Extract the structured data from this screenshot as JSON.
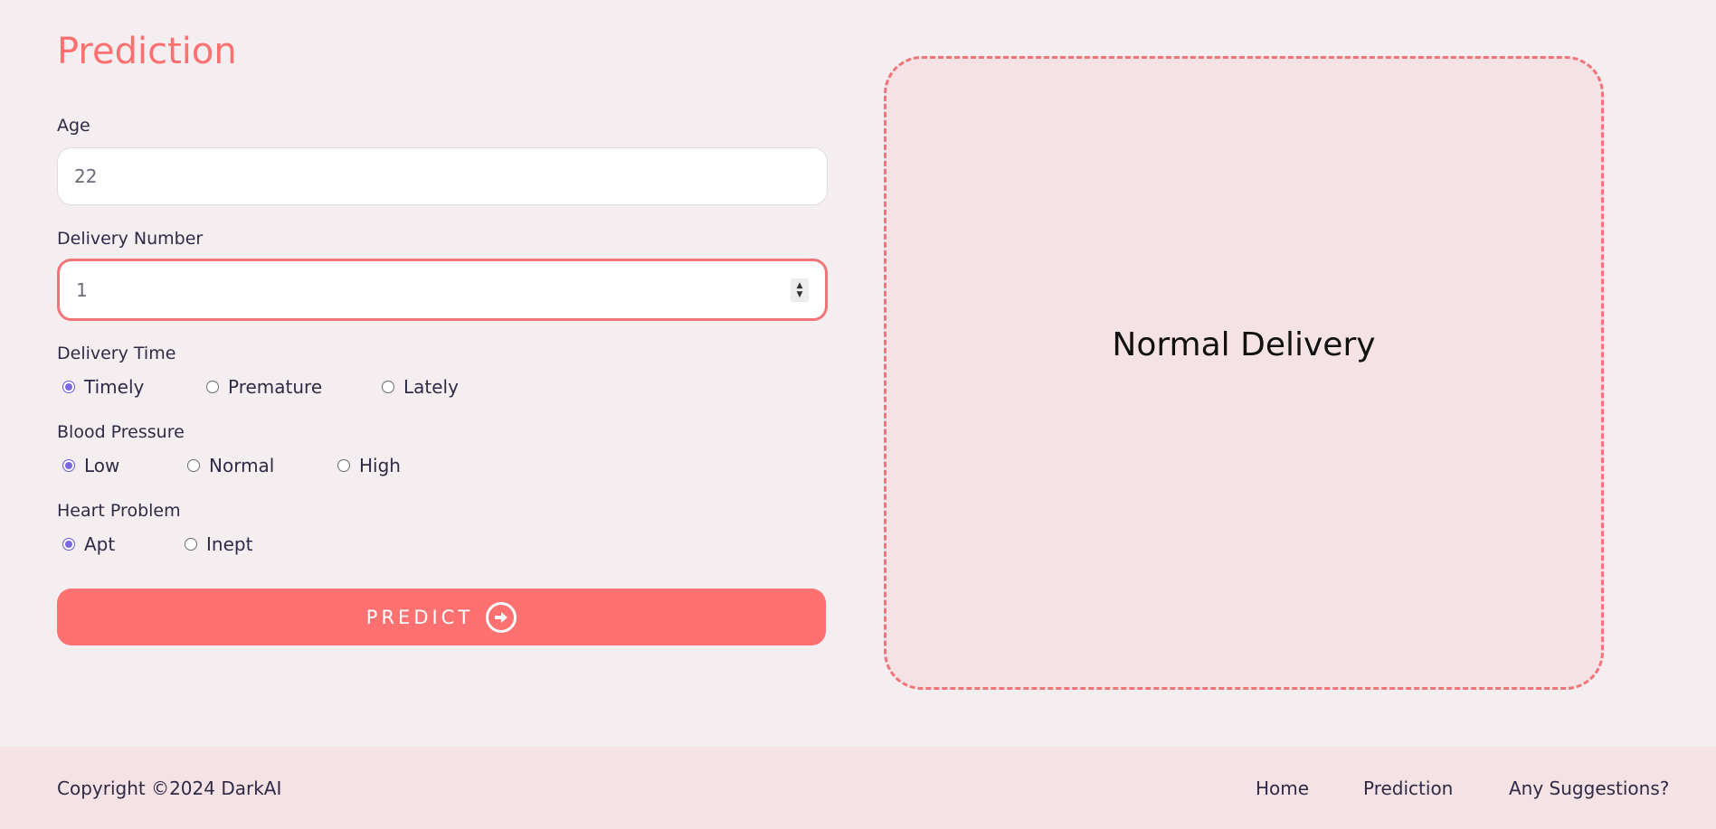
{
  "page": {
    "title": "Prediction"
  },
  "form": {
    "age": {
      "label": "Age",
      "value": "22"
    },
    "delivery_number": {
      "label": "Delivery Number",
      "value": "1"
    },
    "delivery_time": {
      "label": "Delivery Time",
      "options": [
        "Timely",
        "Premature",
        "Lately"
      ],
      "selected": "Timely"
    },
    "blood_pressure": {
      "label": "Blood Pressure",
      "options": [
        "Low",
        "Normal",
        "High"
      ],
      "selected": "Low"
    },
    "heart_problem": {
      "label": "Heart Problem",
      "options": [
        "Apt",
        "Inept"
      ],
      "selected": "Apt"
    },
    "predict_label": "PREDICT"
  },
  "result": {
    "text": "Normal Delivery"
  },
  "footer": {
    "copyright": "Copyright ©2024 DarkAI",
    "links": [
      "Home",
      "Prediction",
      "Any Suggestions?"
    ]
  },
  "colors": {
    "accent": "#ff7171",
    "background": "#f5eef1",
    "result_background": "#f5e2e4",
    "radio_selected": "#7a68e0"
  },
  "icons": {
    "predict": "arrow-right-circle-icon",
    "spinner": "number-stepper-icon"
  }
}
